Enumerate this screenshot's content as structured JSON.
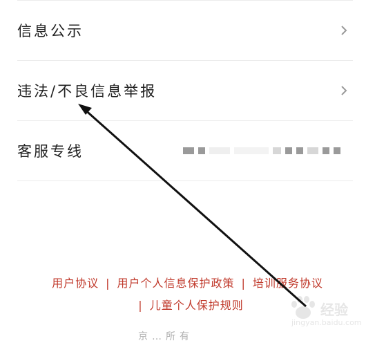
{
  "list": {
    "items": [
      {
        "label": "信息公示"
      },
      {
        "label": "违法/不良信息举报"
      },
      {
        "label": "客服专线"
      }
    ]
  },
  "footer_links": {
    "user_agreement": "用户协议",
    "privacy_policy": "用户个人信息保护政策",
    "training_agreement": "培训服务协议",
    "child_protection": "儿童个人保护规则",
    "separator": "|"
  },
  "bottom_text": "京…所有",
  "watermark": {
    "title": "经验",
    "url": "jingyan.baidu.com"
  },
  "colors": {
    "link": "#c0392b",
    "label": "#222222",
    "arrow": "#111111"
  }
}
